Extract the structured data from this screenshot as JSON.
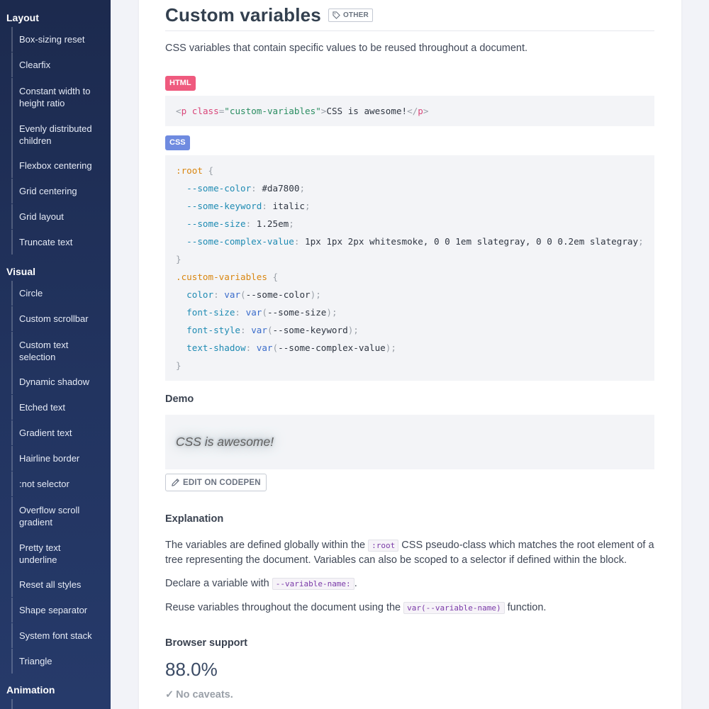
{
  "sidebar": {
    "sections": [
      {
        "title": "Layout",
        "items": [
          "Box-sizing reset",
          "Clearfix",
          "Constant width to height ratio",
          "Evenly distributed children",
          "Flexbox centering",
          "Grid centering",
          "Grid layout",
          "Truncate text"
        ]
      },
      {
        "title": "Visual",
        "items": [
          "Circle",
          "Custom scrollbar",
          "Custom text selection",
          "Dynamic shadow",
          "Etched text",
          "Gradient text",
          "Hairline border",
          ":not selector",
          "Overflow scroll gradient",
          "Pretty text underline",
          "Reset all styles",
          "Shape separator",
          "System font stack",
          "Triangle"
        ]
      },
      {
        "title": "Animation",
        "items": []
      }
    ]
  },
  "page": {
    "title": "Custom variables",
    "tag": "OTHER",
    "description": "CSS variables that contain specific values to be reused throughout a document.",
    "html_badge": "HTML",
    "css_badge": "CSS",
    "html_code": {
      "open_tag": "p",
      "attr": "class",
      "attr_value": "\"custom-variables\"",
      "text": "CSS is awesome!",
      "close_tag": "p"
    },
    "demo_heading": "Demo",
    "demo_text": "CSS is awesome!",
    "codepen_label": "EDIT ON CODEPEN",
    "explanation_heading": "Explanation",
    "explanation_p1_a": "The variables are defined globally within the ",
    "explanation_p1_code": ":root",
    "explanation_p1_b": " CSS pseudo-class which matches the root element of a tree representing the document. Variables can also be scoped to a selector if defined within the block.",
    "explanation_p2_a": "Declare a variable with ",
    "explanation_p2_code": "--variable-name:",
    "explanation_p2_b": ".",
    "explanation_p3_a": "Reuse variables throughout the document using the ",
    "explanation_p3_code": "var(--variable-name)",
    "explanation_p3_b": " function.",
    "browser_support_heading": "Browser support",
    "support_percent": "88.0%",
    "caveat": "No caveats."
  },
  "css_code": [
    [
      [
        "c-sel",
        ":root"
      ],
      [
        "c-punc",
        " {"
      ]
    ],
    [
      [
        "",
        "  "
      ],
      [
        "c-prop",
        "--some-color"
      ],
      [
        "c-punc",
        ":"
      ],
      [
        "",
        " #da7800"
      ],
      [
        "c-punc",
        ";"
      ]
    ],
    [
      [
        "",
        "  "
      ],
      [
        "c-prop",
        "--some-keyword"
      ],
      [
        "c-punc",
        ":"
      ],
      [
        "",
        " italic"
      ],
      [
        "c-punc",
        ";"
      ]
    ],
    [
      [
        "",
        "  "
      ],
      [
        "c-prop",
        "--some-size"
      ],
      [
        "c-punc",
        ":"
      ],
      [
        "",
        " 1.25em"
      ],
      [
        "c-punc",
        ";"
      ]
    ],
    [
      [
        "",
        "  "
      ],
      [
        "c-prop",
        "--some-complex-value"
      ],
      [
        "c-punc",
        ":"
      ],
      [
        "",
        " 1px 1px 2px whitesmoke, 0 0 1em slategray, 0 0 0.2em slategray"
      ],
      [
        "c-punc",
        ";"
      ]
    ],
    [
      [
        "c-punc",
        "}"
      ]
    ],
    [
      [
        "c-sel",
        ".custom-variables"
      ],
      [
        "c-punc",
        " {"
      ]
    ],
    [
      [
        "",
        "  "
      ],
      [
        "c-prop",
        "color"
      ],
      [
        "c-punc",
        ":"
      ],
      [
        "",
        " "
      ],
      [
        "c-fn",
        "var"
      ],
      [
        "c-punc",
        "("
      ],
      [
        "",
        "--some-color"
      ],
      [
        "c-punc",
        ");"
      ]
    ],
    [
      [
        "",
        "  "
      ],
      [
        "c-prop",
        "font-size"
      ],
      [
        "c-punc",
        ":"
      ],
      [
        "",
        " "
      ],
      [
        "c-fn",
        "var"
      ],
      [
        "c-punc",
        "("
      ],
      [
        "",
        "--some-size"
      ],
      [
        "c-punc",
        ");"
      ]
    ],
    [
      [
        "",
        "  "
      ],
      [
        "c-prop",
        "font-style"
      ],
      [
        "c-punc",
        ":"
      ],
      [
        "",
        " "
      ],
      [
        "c-fn",
        "var"
      ],
      [
        "c-punc",
        "("
      ],
      [
        "",
        "--some-keyword"
      ],
      [
        "c-punc",
        ");"
      ]
    ],
    [
      [
        "",
        "  "
      ],
      [
        "c-prop",
        "text-shadow"
      ],
      [
        "c-punc",
        ":"
      ],
      [
        "",
        " "
      ],
      [
        "c-fn",
        "var"
      ],
      [
        "c-punc",
        "("
      ],
      [
        "",
        "--some-complex-value"
      ],
      [
        "c-punc",
        ");"
      ]
    ],
    [
      [
        "c-punc",
        "}"
      ]
    ]
  ],
  "icons": {
    "tag": "tag-icon",
    "codepen": "pencil-icon",
    "caveat": "check-icon"
  }
}
